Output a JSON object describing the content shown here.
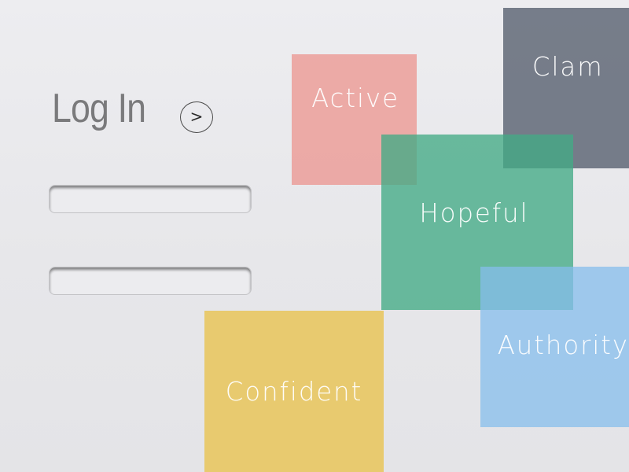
{
  "login": {
    "title": "Log In",
    "go_label": ">",
    "username_value": "",
    "password_value": ""
  },
  "tiles": {
    "active": "Active",
    "clam": "Clam",
    "hopeful": "Hopeful",
    "authority": "Authority",
    "confident": "Confident"
  },
  "colors": {
    "background": "#e9e9ec",
    "active": "#eea8a3",
    "clam": "#77818c",
    "hopeful": "#63bb9e",
    "authority": "#9ecbea",
    "confident": "#e8cc74"
  },
  "icons": {
    "go": "chevron-right-circle-icon"
  }
}
